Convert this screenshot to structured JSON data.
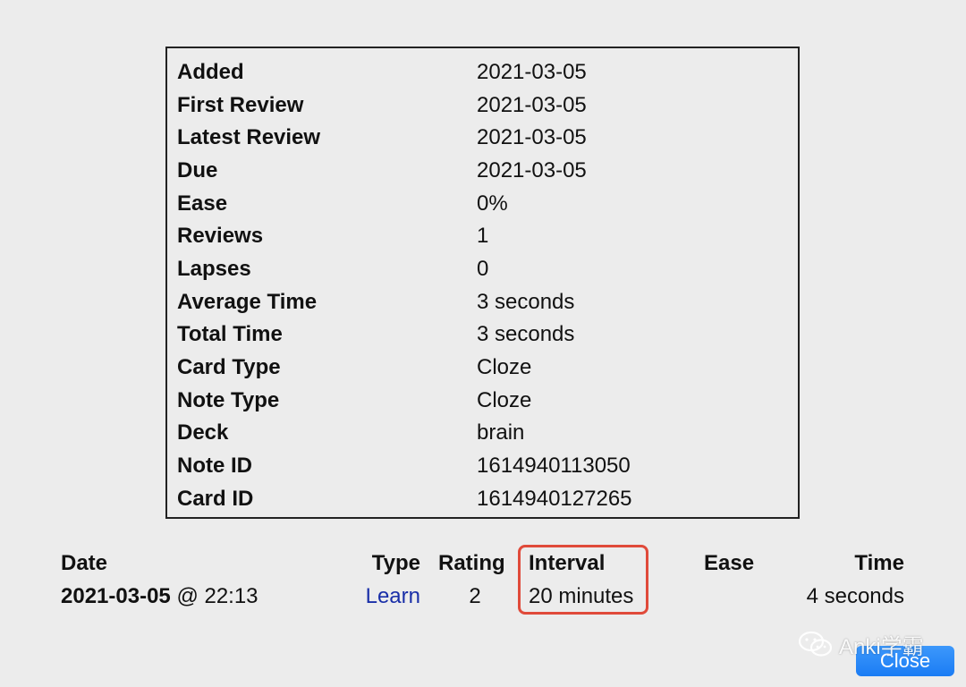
{
  "card_info": {
    "rows": [
      {
        "label": "Added",
        "value": "2021-03-05"
      },
      {
        "label": "First Review",
        "value": "2021-03-05"
      },
      {
        "label": "Latest Review",
        "value": "2021-03-05"
      },
      {
        "label": "Due",
        "value": "2021-03-05"
      },
      {
        "label": "Ease",
        "value": "0%"
      },
      {
        "label": "Reviews",
        "value": "1"
      },
      {
        "label": "Lapses",
        "value": "0"
      },
      {
        "label": "Average Time",
        "value": "3 seconds"
      },
      {
        "label": "Total Time",
        "value": "3 seconds"
      },
      {
        "label": "Card Type",
        "value": "Cloze"
      },
      {
        "label": "Note Type",
        "value": "Cloze"
      },
      {
        "label": "Deck",
        "value": "brain"
      },
      {
        "label": "Note ID",
        "value": "1614940113050"
      },
      {
        "label": "Card ID",
        "value": "1614940127265"
      }
    ]
  },
  "review_log": {
    "headers": {
      "date": "Date",
      "type": "Type",
      "rating": "Rating",
      "interval": "Interval",
      "ease": "Ease",
      "time": "Time"
    },
    "rows": [
      {
        "date": "2021-03-05",
        "time_of_day": "@ 22:13",
        "type": "Learn",
        "rating": "2",
        "interval": "20 minutes",
        "ease": "",
        "time": "4 seconds"
      }
    ]
  },
  "watermark": {
    "text": "Anki学霸",
    "icon": "wechat-icon"
  },
  "buttons": {
    "close_label": "Close"
  },
  "colors": {
    "highlight": "#e04a3a",
    "link": "#1a2fa8",
    "button": "#1a7cf4"
  }
}
